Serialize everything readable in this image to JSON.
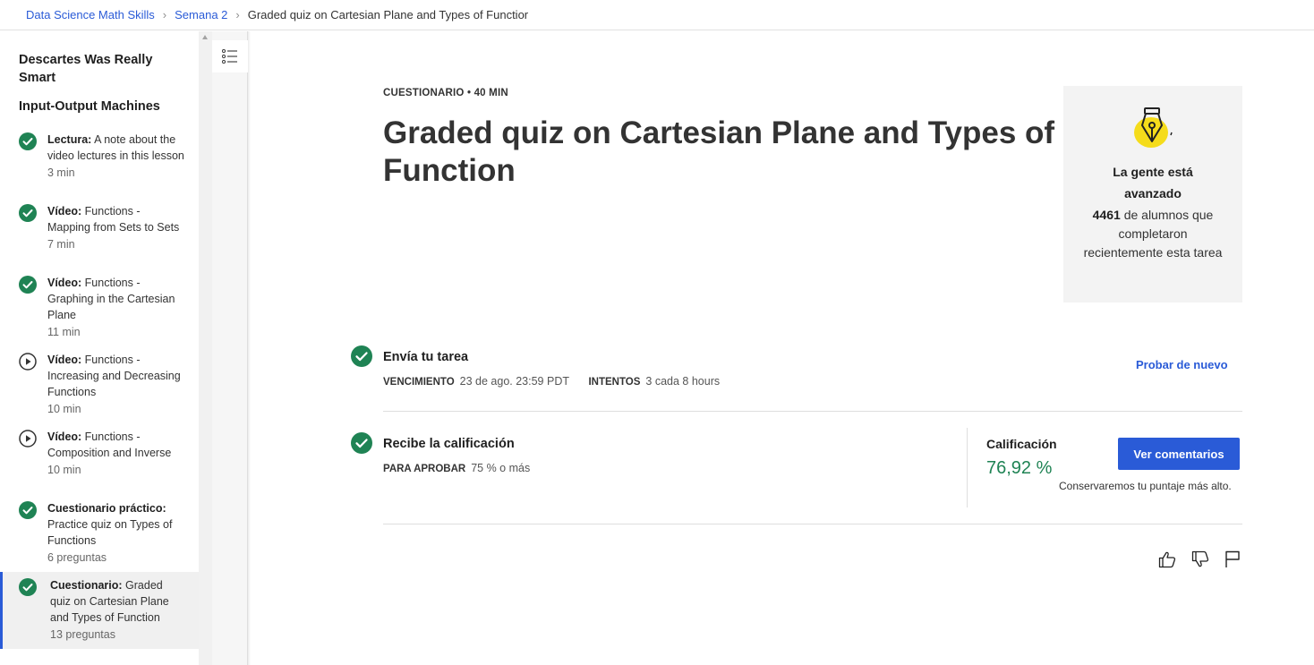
{
  "breadcrumb": {
    "items": [
      "Data Science Math Skills",
      "Semana 2"
    ],
    "current": "Graded quiz on Cartesian Plane and Types of Functior"
  },
  "sidebar": {
    "section_title": "Descartes Was Really Smart",
    "lesson_title": "Input-Output Machines",
    "items": [
      {
        "type": "Lectura:",
        "title": " A note about the video lectures in this lesson",
        "meta": "3 min",
        "status": "completed"
      },
      {
        "type": "Vídeo:",
        "title": " Functions - Mapping from Sets to Sets",
        "meta": "7 min",
        "status": "completed"
      },
      {
        "type": "Vídeo:",
        "title": " Functions - Graphing in the Cartesian Plane",
        "meta": "11 min",
        "status": "completed"
      },
      {
        "type": "Vídeo:",
        "title": " Functions - Increasing and Decreasing Functions",
        "meta": "10 min",
        "status": "play"
      },
      {
        "type": "Vídeo:",
        "title": " Functions - Composition and Inverse",
        "meta": "10 min",
        "status": "play"
      },
      {
        "type": "Cuestionario práctico:",
        "title": " Practice quiz on Types of Functions",
        "meta": "6 preguntas",
        "status": "completed"
      },
      {
        "type": "Cuestionario:",
        "title": " Graded quiz on Cartesian Plane and Types of Function",
        "meta": "13 preguntas",
        "status": "completed",
        "active": true
      }
    ]
  },
  "main": {
    "eyebrow": "CUESTIONARIO • 40 MIN",
    "title": "Graded quiz on Cartesian Plane and Types of Function",
    "stats": {
      "heading": "La gente está avanzado",
      "count": "4461",
      "text": " de alumnos que completaron recientemente esta tarea"
    },
    "submit": {
      "title": "Envía tu tarea",
      "due_label": "VENCIMIENTO",
      "due_value": "23 de ago. 23:59 PDT",
      "attempts_label": "INTENTOS",
      "attempts_value": "3 cada 8 hours",
      "retry_label": "Probar de nuevo"
    },
    "grade": {
      "title": "Recibe la calificación",
      "pass_label": "PARA APROBAR",
      "pass_value": "75 % o más",
      "grade_label": "Calificación",
      "grade_value": "76,92 %",
      "view_feedback_label": "Ver comentarios",
      "note": "Conservaremos tu puntaje más alto."
    }
  },
  "colors": {
    "accent": "#2a5bd7",
    "success": "#1f8354",
    "check_green": "#1f8354",
    "badge_yellow": "#f5dc1b"
  },
  "icons": [
    "outline-toggle-icon",
    "check-circle-icon",
    "play-circle-icon",
    "pen-nib-icon",
    "thumbs-up-icon",
    "thumbs-down-icon",
    "flag-icon"
  ]
}
